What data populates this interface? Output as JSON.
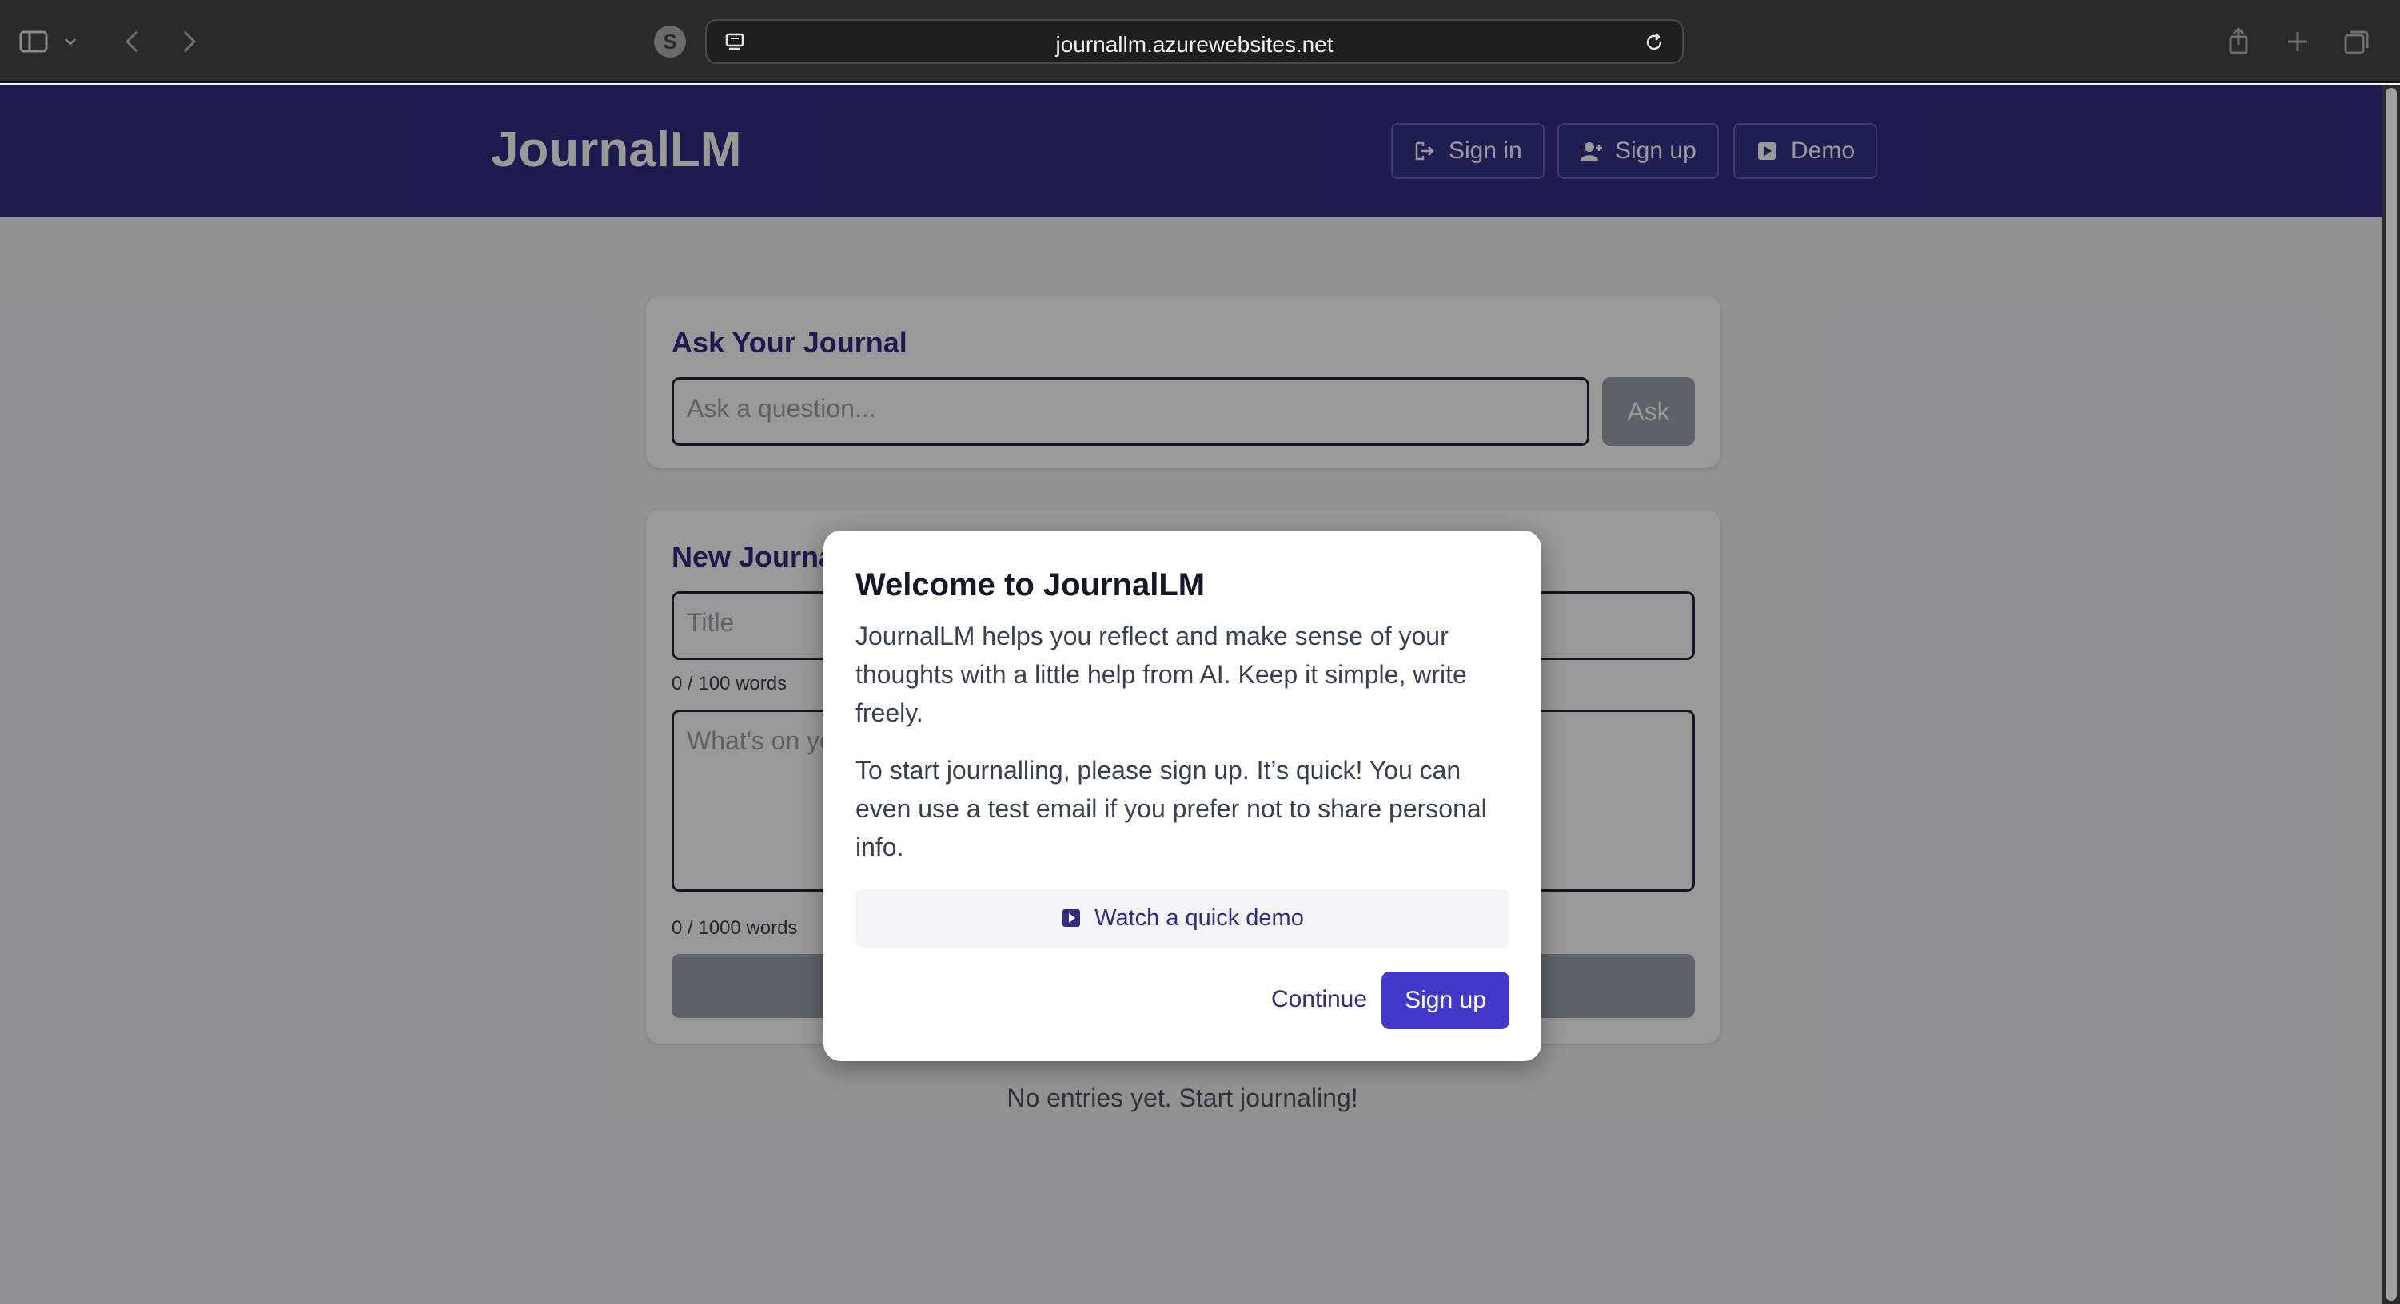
{
  "browser": {
    "url": "journallm.azurewebsites.net",
    "profile_initial": "S"
  },
  "header": {
    "brand": "JournalLM",
    "sign_in_label": "Sign in",
    "sign_up_label": "Sign up",
    "demo_label": "Demo"
  },
  "ask": {
    "title": "Ask Your Journal",
    "placeholder": "Ask a question...",
    "button_label": "Ask"
  },
  "new_entry": {
    "title": "New Journal Entry",
    "title_placeholder": "Title",
    "title_counter": "0 / 100 words",
    "body_placeholder": "What's on your mind?",
    "body_counter": "0 / 1000 words"
  },
  "empty_state": "No entries yet. Start journaling!",
  "modal": {
    "title": "Welcome to JournalLM",
    "paragraph1": "JournalLM helps you reflect and make sense of your thoughts with a little help from AI. Keep it simple, write freely.",
    "paragraph2": "To start journalling, please sign up. It’s quick! You can even use a test email if you prefer not to share personal info.",
    "demo_link": "Watch a quick demo",
    "continue_label": "Continue",
    "signup_label": "Sign up"
  },
  "colors": {
    "header_bg": "#312e81",
    "accent": "#4338ca",
    "button_disabled": "#9ca3af"
  }
}
